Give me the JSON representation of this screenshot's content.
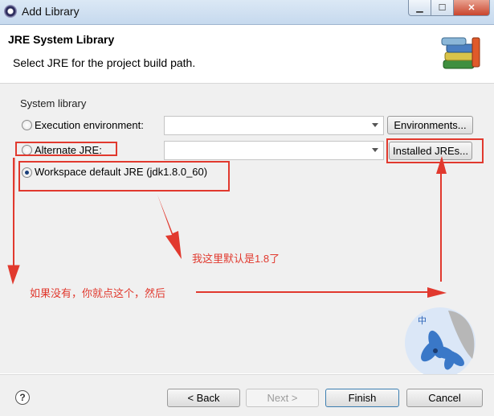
{
  "window": {
    "title": "Add Library",
    "minimize_icon": "minimize-icon",
    "maximize_icon": "maximize-icon",
    "close_icon": "close-icon"
  },
  "header": {
    "title": "JRE System Library",
    "description": "Select JRE for the project build path."
  },
  "group": {
    "label": "System library",
    "options": [
      {
        "label": "Execution environment:",
        "checked": false
      },
      {
        "label": "Alternate JRE:",
        "checked": false
      },
      {
        "label": "Workspace default JRE (jdk1.8.0_60)",
        "checked": true
      }
    ],
    "environments_button": "Environments...",
    "installed_jres_button": "Installed JREs..."
  },
  "annotations": {
    "note_default": "我这里默认是1.8了",
    "note_steps": "如果没有，你就点这个，然后",
    "badge": "中"
  },
  "footer": {
    "help": "?",
    "back": "< Back",
    "next": "Next >",
    "finish": "Finish",
    "cancel": "Cancel"
  },
  "colors": {
    "annotation": "#e1392e",
    "title_bar": "#c6d9ee",
    "dialog_bg": "#f0f0f0"
  }
}
